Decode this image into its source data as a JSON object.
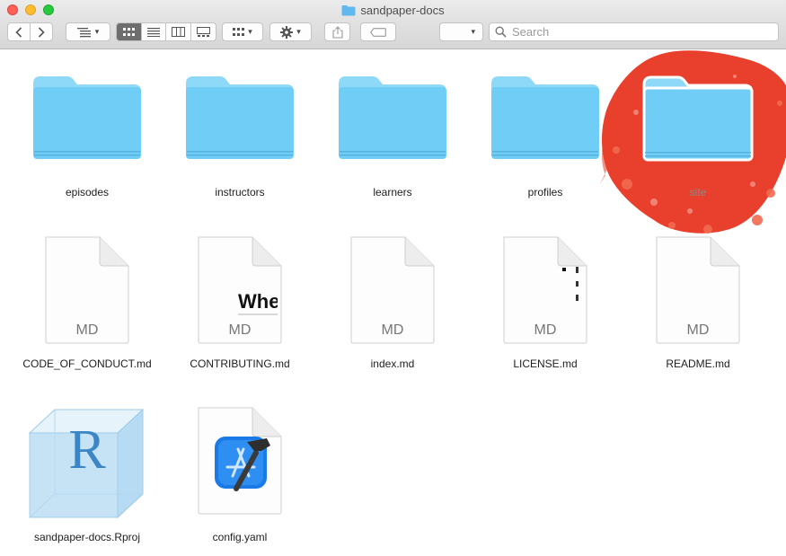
{
  "window": {
    "title": "sandpaper-docs"
  },
  "toolbar": {
    "back_icon": "chevron-left-icon",
    "forward_icon": "chevron-right-icon",
    "view_modes": [
      "icon-view",
      "list-view",
      "column-view",
      "gallery-view"
    ],
    "active_view": "icon-view",
    "search_placeholder": "Search"
  },
  "folders": [
    {
      "name": "episodes"
    },
    {
      "name": "instructors"
    },
    {
      "name": "learners"
    },
    {
      "name": "profiles"
    },
    {
      "name": "site"
    }
  ],
  "files": [
    {
      "name": "CODE_OF_CONDUCT.md",
      "ext": "MD"
    },
    {
      "name": "CONTRIBUTING.md",
      "ext": "MD",
      "preview_text": "Whe"
    },
    {
      "name": "index.md",
      "ext": "MD"
    },
    {
      "name": "LICENSE.md",
      "ext": "MD"
    },
    {
      "name": "README.md",
      "ext": "MD"
    }
  ],
  "other_files": [
    {
      "name": "sandpaper-docs.Rproj",
      "glyph": "R"
    },
    {
      "name": "config.yaml"
    }
  ],
  "colors": {
    "folder": "#6fcdf6",
    "folder_tab": "#8ed8f8",
    "splash": "#e8402c",
    "rproj": "#3d86c6"
  }
}
